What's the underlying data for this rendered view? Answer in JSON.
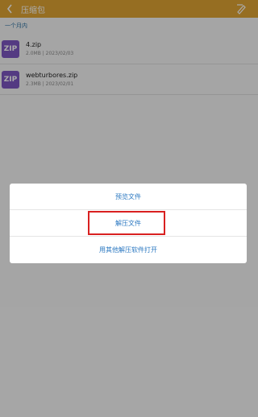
{
  "header": {
    "title": "压缩包",
    "back_icon": "back-arrow-icon",
    "edit_icon": "pen-icon"
  },
  "list": {
    "group_label": "一个月内",
    "items": [
      {
        "name": "4.zip",
        "info": "2.0MB | 2023/02/03",
        "icon_label": "ZIP"
      },
      {
        "name": "webturbores.zip",
        "info": "2.3MB | 2023/02/01",
        "icon_label": "ZIP"
      }
    ]
  },
  "dialog": {
    "options": [
      {
        "label": "预览文件"
      },
      {
        "label": "解压文件"
      },
      {
        "label": "用其他解压软件打开"
      }
    ]
  },
  "colors": {
    "appbar": "#e0a534",
    "zip_icon": "#7e57c2",
    "accent": "#2b78c1",
    "highlight": "#d92020"
  }
}
